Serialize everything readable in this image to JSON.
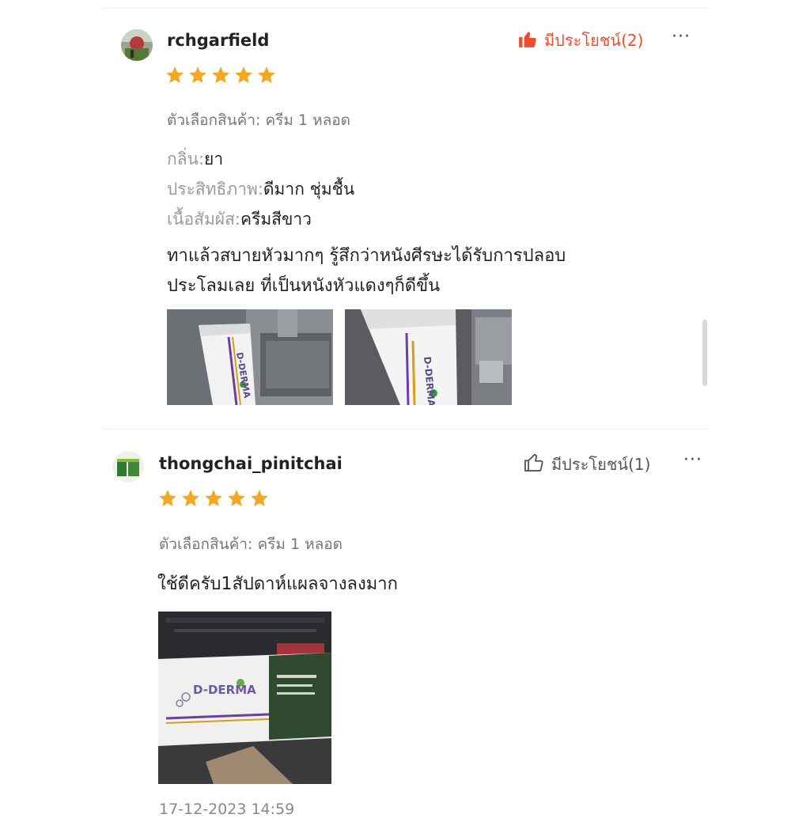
{
  "reviews": [
    {
      "username": "rchgarfield",
      "helpful_label": "มีประโยชน์(2)",
      "more_label": "···",
      "rating": 5,
      "variant": "ตัวเลือกสินค้า: ครีม 1 หลอด",
      "attributes": [
        {
          "key": "กลิ่น:",
          "value": "ยา"
        },
        {
          "key": "ประสิทธิภาพ:",
          "value": "ดีมาก ชุ่มชื้น"
        },
        {
          "key": "เนื้อสัมผัส:",
          "value": "ครีมสีขาว"
        }
      ],
      "comment_lines": [
        "ทาแล้วสบายหัวมากๆ รู้สึกว่าหนังศีรษะได้รับการปลอบ",
        "ประโลมเลย ที่เป็นหนังหัวแดงๆก็ดีขึ้น"
      ],
      "photos": [
        {
          "product_text": "D-DERMA"
        },
        {
          "product_text": "D-DERMA"
        }
      ]
    },
    {
      "username": "thongchai_pinitchai",
      "helpful_label": "มีประโยชน์(1)",
      "more_label": "···",
      "rating": 5,
      "variant": "ตัวเลือกสินค้า: ครีม 1 หลอด",
      "comment_lines": [
        "ใช้ดีครับ1สัปดาห์แผลจางลงมาก"
      ],
      "photos": [
        {
          "product_text": "D-DERMA"
        }
      ],
      "timestamp": "17-12-2023 14:59"
    }
  ],
  "colors": {
    "star": "#f5a623",
    "helpful_active": "#ee4d2d",
    "helpful_inactive": "#555555"
  },
  "icons": {
    "star": "star-icon",
    "thumbs_up_filled": "thumbs-up-filled-icon",
    "thumbs_up_outline": "thumbs-up-outline-icon",
    "more": "more-options-icon"
  }
}
